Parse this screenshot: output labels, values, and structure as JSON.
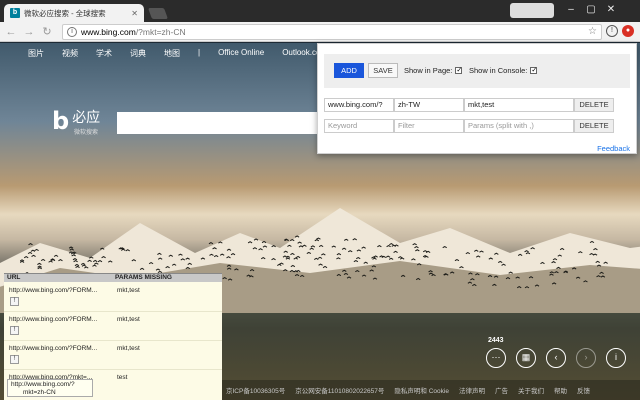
{
  "browser": {
    "tab_title": "微软必应搜索 - 全球搜索",
    "tab_favicon": "b",
    "url_host": "www.bing.com",
    "url_rest": "/?mkt=zh-CN",
    "colors": {
      "titlebar": "#2b2b2b",
      "extension_badge": "#d93025"
    }
  },
  "bing": {
    "nav": [
      "图片",
      "视频",
      "学术",
      "词典",
      "地图",
      "Office Online",
      "Outlook.com"
    ],
    "logo_text": "必应",
    "logo_sub": "微软搜索",
    "image_count": "2443",
    "footer": [
      "京ICP备10036305号",
      "京公网安备11010802022657号",
      "隐私声明和 Cookie",
      "法律声明",
      "广告",
      "关于我们",
      "帮助",
      "反馈"
    ]
  },
  "popup": {
    "add_label": "ADD",
    "save_label": "SAVE",
    "show_in_page_label": "Show in Page:",
    "show_in_console_label": "Show in Console:",
    "row1": {
      "url": "www.bing.com/?",
      "filter": "zh-TW",
      "params": "mkt,test",
      "delete": "DELETE"
    },
    "row2": {
      "keyword_ph": "Keyword",
      "filter_ph": "Filter",
      "params_ph": "Params (split with ,)",
      "delete": "DELETE"
    },
    "feedback": "Feedback",
    "accent": "#1a56db"
  },
  "panel": {
    "col_url": "URL",
    "col_params": "PARAMS MISSING",
    "rows": [
      {
        "url": "http://www.bing.com/?FORM...",
        "params": "mkt,test",
        "info": "!"
      },
      {
        "url": "http://www.bing.com/?FORM...",
        "params": "mkt,test",
        "info": "!"
      },
      {
        "url": "http://www.bing.com/?FORM...",
        "params": "mkt,test",
        "info": "!"
      },
      {
        "url": "http://www.bing.com/?mkt=...",
        "params": "test",
        "info": "!"
      }
    ],
    "tooltip_line1": "http://www.bing.com/?",
    "tooltip_line2": "mkt=zh-CN"
  }
}
